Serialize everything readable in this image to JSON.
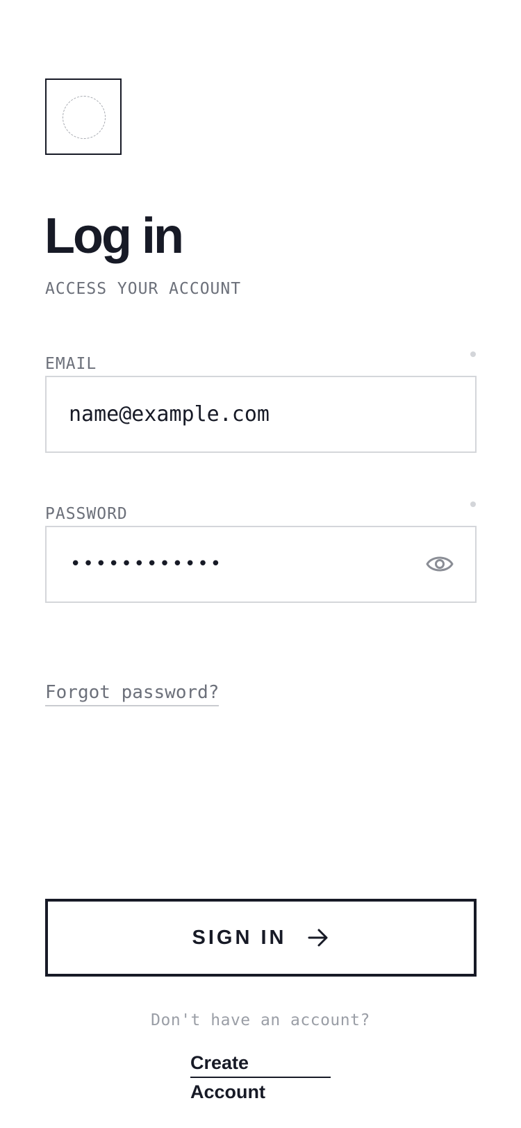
{
  "header": {
    "logo_icon": "logo-placeholder-icon",
    "title": "Log in",
    "subtitle": "ACCESS YOUR ACCOUNT"
  },
  "form": {
    "email": {
      "label": "EMAIL",
      "value": "name@example.com",
      "required": true
    },
    "password": {
      "label": "PASSWORD",
      "masked_value": "••••••••••••",
      "required": true,
      "toggle_icon": "eye-icon"
    },
    "forgot_password_label": "Forgot password?"
  },
  "actions": {
    "signin_label": "SIGN IN",
    "signin_icon": "arrow-right-icon"
  },
  "footer": {
    "prompt": "Don't have an account?",
    "create_line1": "Create",
    "create_line2": "Account"
  },
  "colors": {
    "primary": "#171a26",
    "muted": "#6c707a",
    "light_muted": "#9a9ea6",
    "border": "#d4d6da",
    "background": "#ffffff"
  }
}
